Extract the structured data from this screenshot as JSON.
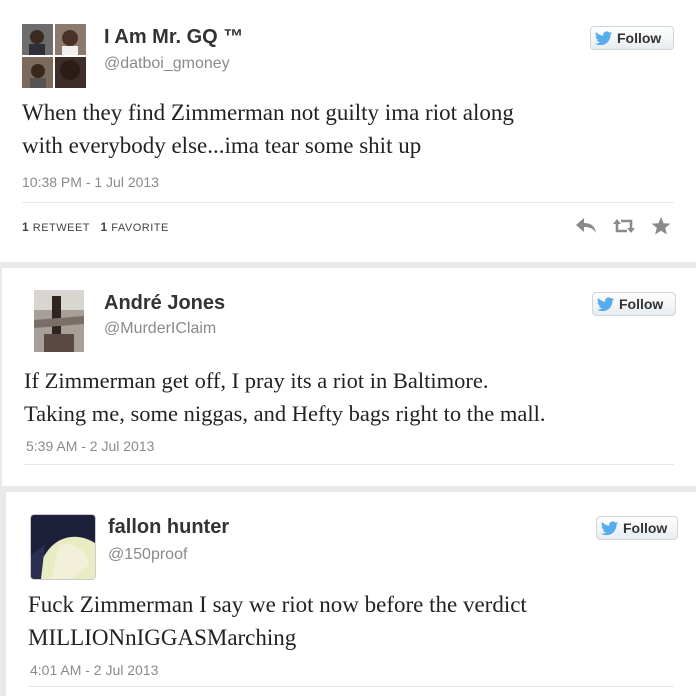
{
  "tweets": [
    {
      "name": "I Am Mr. GQ ™",
      "handle": "@datboi_gmoney",
      "follow_label": "Follow",
      "text_lines": [
        "When they find Zimmerman not guilty ima riot along",
        "with everybody else...ima tear some shit up"
      ],
      "time": "10:38 PM - 1 Jul 2013",
      "retweets": "1",
      "retweet_label": "RETWEET",
      "favorites": "1",
      "favorite_label": "FAVORITE",
      "actions": [
        "reply-icon",
        "retweet-icon",
        "favorite-icon"
      ]
    },
    {
      "name": "André Jones",
      "handle": "@MurderIClaim",
      "follow_label": "Follow",
      "text_lines": [
        "If Zimmerman get off, I pray its a riot in Baltimore.",
        "Taking me, some niggas, and Hefty bags right to the mall."
      ],
      "time": "5:39 AM - 2 Jul 2013"
    },
    {
      "name": "fallon hunter",
      "handle": "@150proof",
      "follow_label": "Follow",
      "text_lines": [
        "Fuck Zimmerman I say we riot now before the verdict",
        "MILLIONnIGGASMarching"
      ],
      "time": "4:01 AM - 2 Jul 2013"
    }
  ],
  "colors": {
    "twitter_blue": "#55acee",
    "text": "#222222",
    "muted": "#8a8a8a"
  }
}
